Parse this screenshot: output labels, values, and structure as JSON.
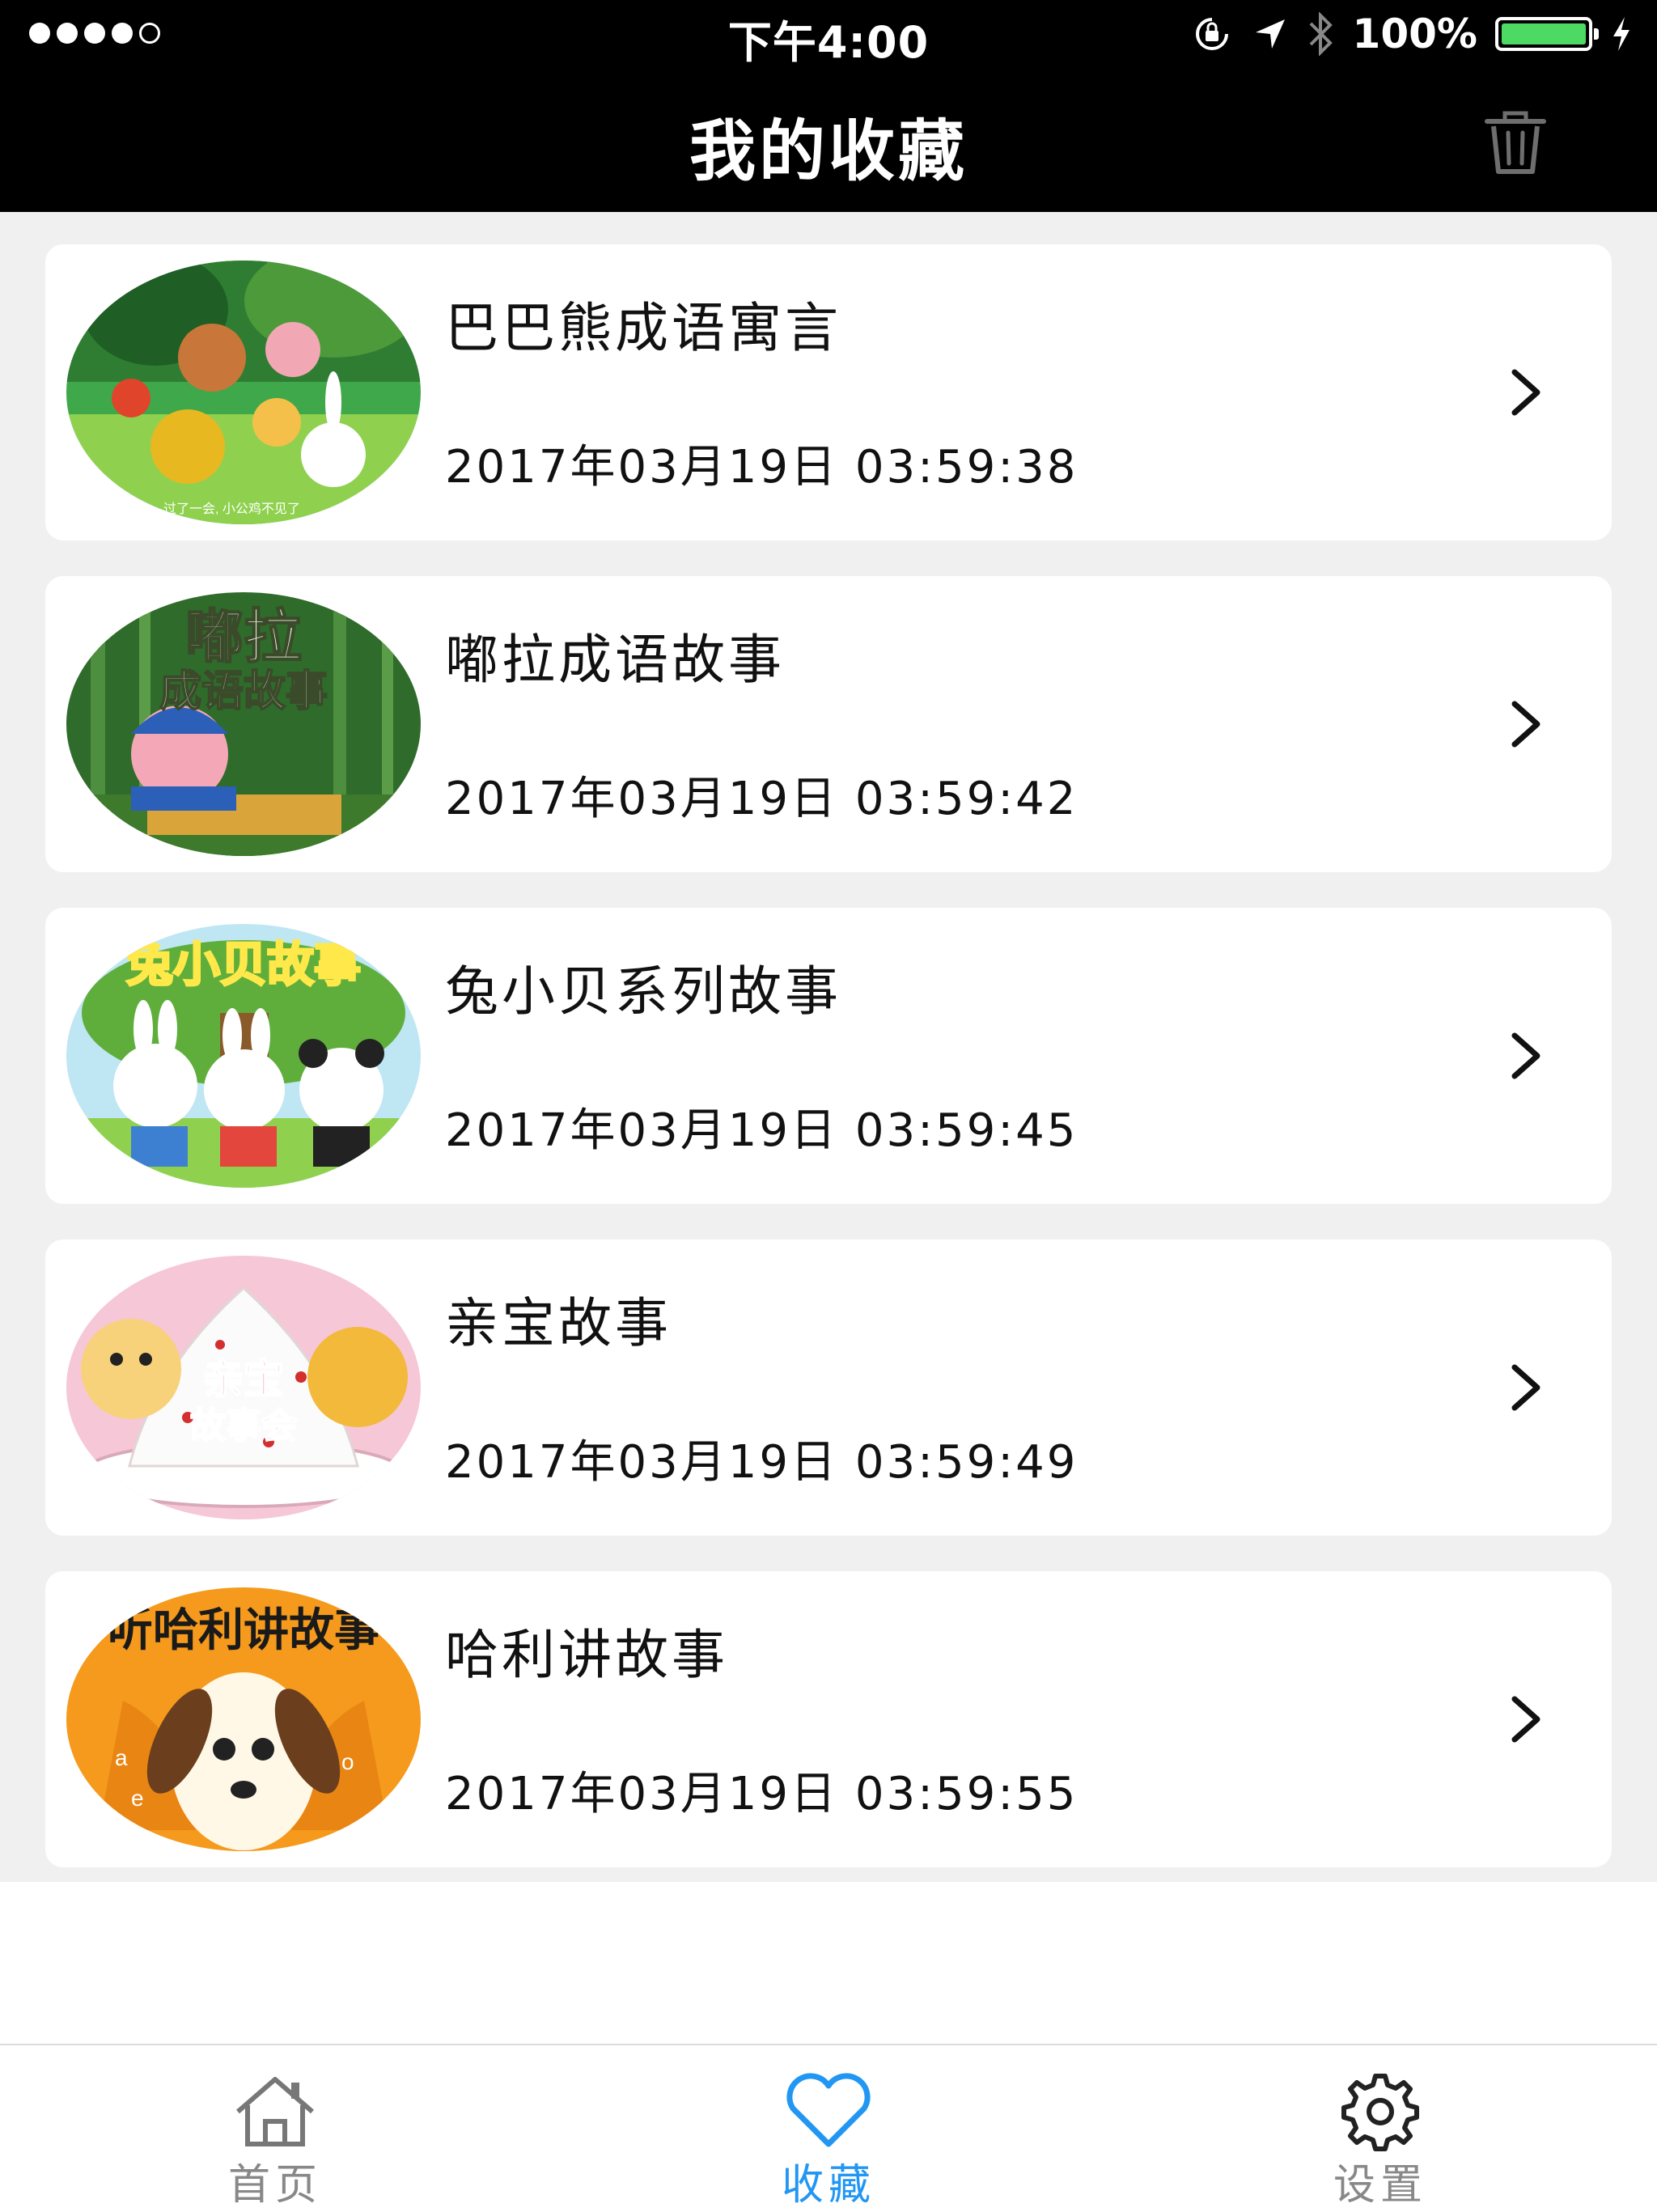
{
  "status_bar": {
    "time": "下午4:00",
    "battery_percent": "100%",
    "battery_level": 1.0,
    "battery_color": "#4cd964",
    "icons": [
      "signal-dots-icon",
      "rotation-lock-icon",
      "location-arrow-icon",
      "bluetooth-icon",
      "battery-icon",
      "charging-bolt-icon"
    ]
  },
  "header": {
    "title": "我的收藏",
    "trash_icon": "trash-icon"
  },
  "favorites": [
    {
      "title": "巴巴熊成语寓言",
      "date": "2017年03月19日 03:59:38",
      "thumb_text": "过了一会, 小公鸡不见了"
    },
    {
      "title": "嘟拉成语故事",
      "date": "2017年03月19日 03:59:42",
      "thumb_text": "嘟拉成语故事"
    },
    {
      "title": "兔小贝系列故事",
      "date": "2017年03月19日 03:59:45",
      "thumb_text": "兔小贝故事"
    },
    {
      "title": "亲宝故事",
      "date": "2017年03月19日 03:59:49",
      "thumb_text": "亲宝故事会"
    },
    {
      "title": "哈利讲故事",
      "date": "2017年03月19日 03:59:55",
      "thumb_text": "听哈利讲故事"
    }
  ],
  "tab_bar": {
    "tabs": [
      {
        "label": "首页",
        "icon": "home-icon",
        "active": false
      },
      {
        "label": "收藏",
        "icon": "heart-icon",
        "active": true
      },
      {
        "label": "设置",
        "icon": "gear-icon",
        "active": false
      }
    ],
    "active_color": "#2196f3",
    "inactive_color": "#888888"
  },
  "colors": {
    "header_background": "#000000",
    "list_background": "#f0f0f0"
  }
}
